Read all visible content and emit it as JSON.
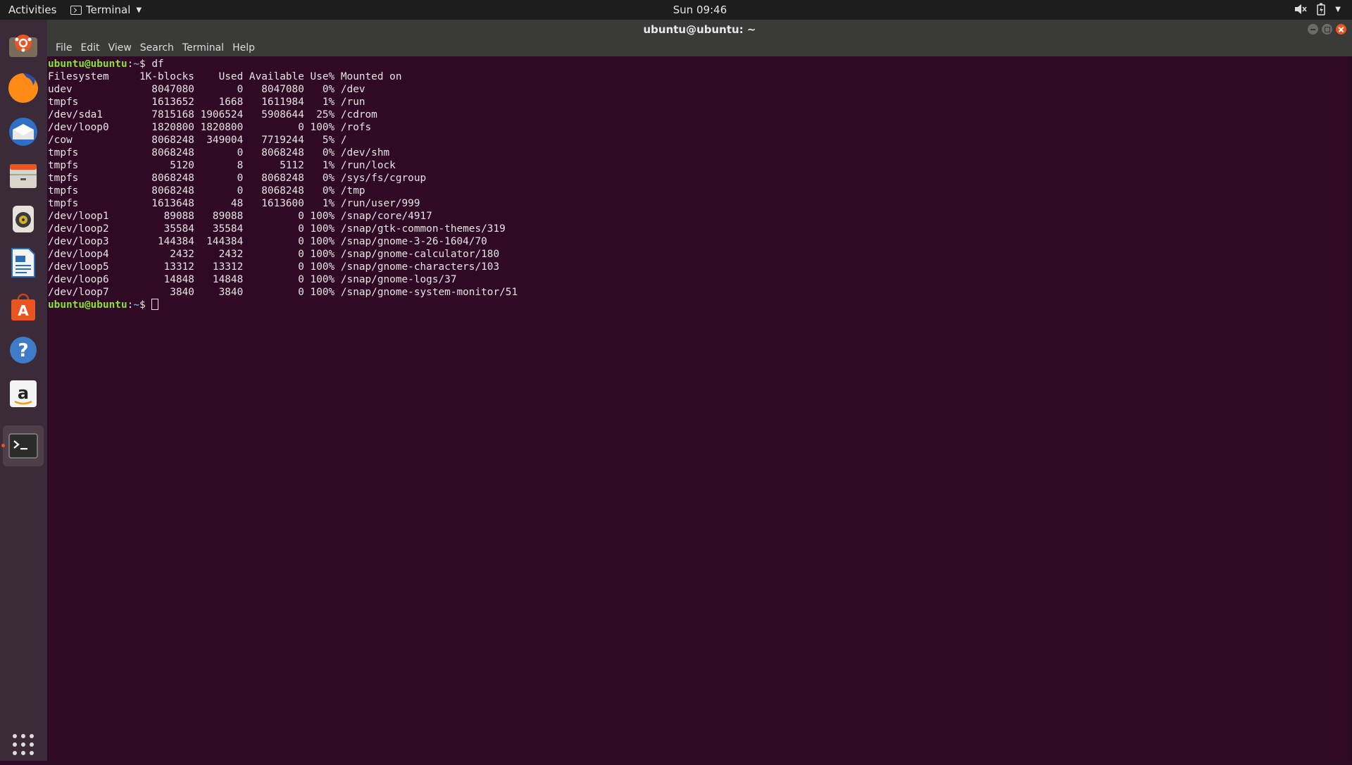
{
  "topbar": {
    "activities": "Activities",
    "app_name": "Terminal",
    "clock": "Sun 09:46"
  },
  "window": {
    "title": "ubuntu@ubuntu: ~"
  },
  "menubar": {
    "items": [
      "File",
      "Edit",
      "View",
      "Search",
      "Terminal",
      "Help"
    ]
  },
  "dock": {
    "apps": [
      "ubuntu-installer-icon",
      "firefox-icon",
      "thunderbird-icon",
      "files-icon",
      "rhythmbox-icon",
      "libreoffice-writer-icon",
      "software-center-icon",
      "help-icon",
      "amazon-icon",
      "terminal-icon"
    ]
  },
  "terminal": {
    "prompt_user": "ubuntu@ubuntu",
    "prompt_sep": ":",
    "prompt_dir": "~",
    "prompt_dollar": "$",
    "command": " df",
    "header": "Filesystem     1K-blocks    Used Available Use% Mounted on",
    "rows": [
      "udev             8047080       0   8047080   0% /dev",
      "tmpfs            1613652    1668   1611984   1% /run",
      "/dev/sda1        7815168 1906524   5908644  25% /cdrom",
      "/dev/loop0       1820800 1820800         0 100% /rofs",
      "/cow             8068248  349004   7719244   5% /",
      "tmpfs            8068248       0   8068248   0% /dev/shm",
      "tmpfs               5120       8      5112   1% /run/lock",
      "tmpfs            8068248       0   8068248   0% /sys/fs/cgroup",
      "tmpfs            8068248       0   8068248   0% /tmp",
      "tmpfs            1613648      48   1613600   1% /run/user/999",
      "/dev/loop1         89088   89088         0 100% /snap/core/4917",
      "/dev/loop2         35584   35584         0 100% /snap/gtk-common-themes/319",
      "/dev/loop3        144384  144384         0 100% /snap/gnome-3-26-1604/70",
      "/dev/loop4          2432    2432         0 100% /snap/gnome-calculator/180",
      "/dev/loop5         13312   13312         0 100% /snap/gnome-characters/103",
      "/dev/loop6         14848   14848         0 100% /snap/gnome-logs/37",
      "/dev/loop7          3840    3840         0 100% /snap/gnome-system-monitor/51"
    ]
  },
  "colors": {
    "terminal_bg": "#300a24",
    "prompt_green": "#8ae234",
    "path_blue": "#729fcf",
    "accent": "#e95420"
  }
}
